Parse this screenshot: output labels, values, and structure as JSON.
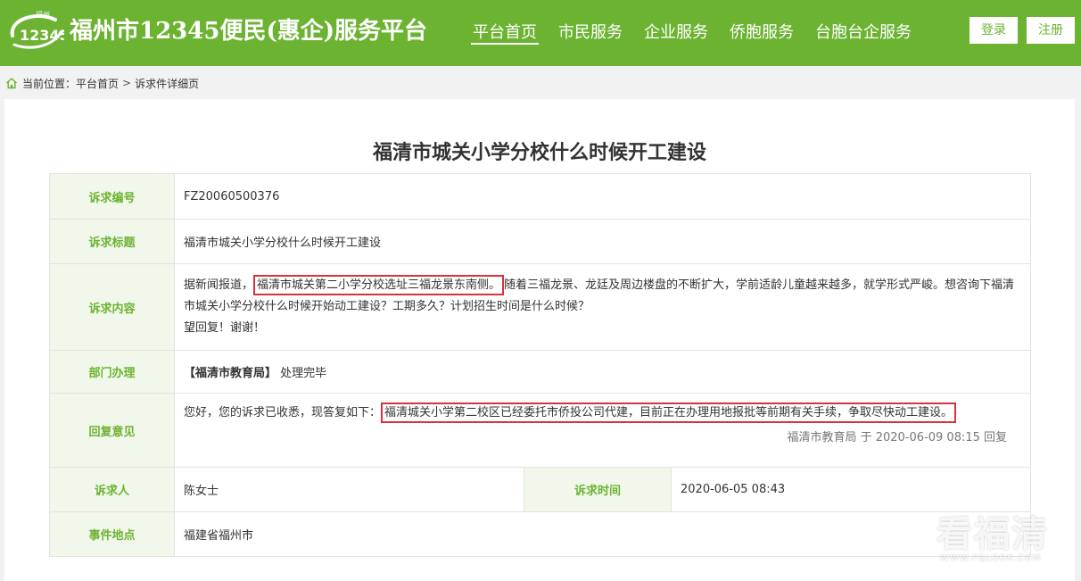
{
  "header": {
    "logo_text": "福州",
    "logo_number": "12345",
    "brand": "福州市12345便民(惠企)服务平台",
    "nav": [
      {
        "label": "平台首页"
      },
      {
        "label": "市民服务"
      },
      {
        "label": "企业服务"
      },
      {
        "label": "侨胞服务"
      },
      {
        "label": "台胞台企服务"
      }
    ],
    "login_label": "登录",
    "register_label": "注册"
  },
  "breadcrumb": {
    "prefix": "当前位置：",
    "home": "平台首页",
    "separator": ">",
    "current": "诉求件详细页"
  },
  "page": {
    "title": "福清市城关小学分校什么时候开工建设"
  },
  "detail": {
    "id_label": "诉求编号",
    "id_value": "FZ20060500376",
    "subject_label": "诉求标题",
    "subject_value": "福清市城关小学分校什么时候开工建设",
    "content_label": "诉求内容",
    "content_pre": "据新闻报道，",
    "content_highlight": "福清市城关第二小学分校选址三福龙景东南侧。",
    "content_post": "随着三福龙景、龙廷及周边楼盘的不断扩大，学前适龄儿童越来越多，就学形式严峻。想咨询下福清市城关小学分校什么时候开始动工建设？工期多久？计划招生时间是什么时候？",
    "content_line3": "望回复！谢谢！",
    "dept_label": "部门办理",
    "dept_name": "【福清市教育局】",
    "dept_status": "处理完毕",
    "reply_label": "回复意见",
    "reply_pre": "您好，您的诉求已收悉，现答复如下：",
    "reply_highlight": "福清城关小学第二校区已经委托市侨投公司代建，目前正在办理用地报批等前期有关手续，争取尽快动工建设。",
    "reply_meta": "福清市教育局 于 2020-06-09 08:15 回复",
    "requester_label": "诉求人",
    "requester_value": "陈女士",
    "time_label": "诉求时间",
    "time_value": "2020-06-05 08:43",
    "location_label": "事件地点",
    "location_value": "福建省福州市"
  },
  "watermark": {
    "main": "看福清",
    "sub": "WWW.FQLOOK.COM"
  },
  "colors": {
    "brand_green": "#6cb332",
    "label_bg": "#f1f7ea",
    "highlight_red": "#d9323b"
  }
}
